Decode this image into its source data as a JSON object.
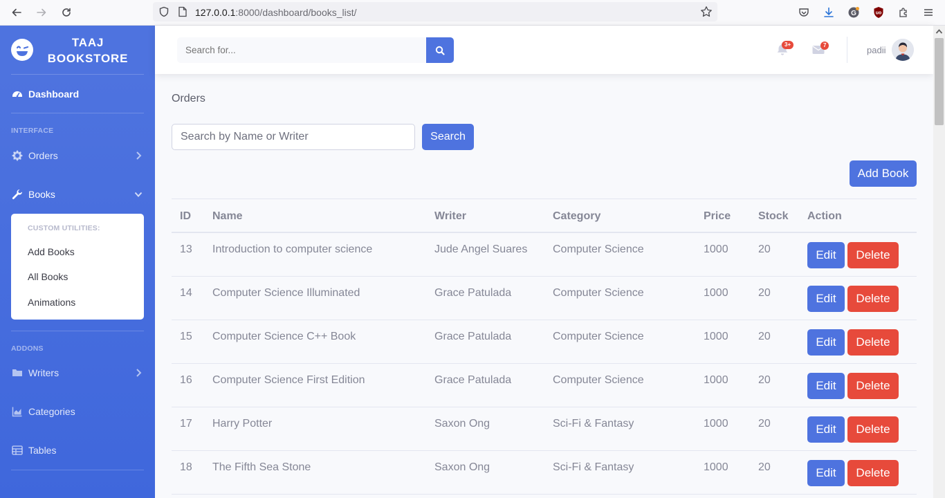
{
  "browser": {
    "url_host": "127.0.0.1",
    "url_rest": ":8000/dashboard/books_list/"
  },
  "brand": {
    "line1": "TAAJ",
    "line2": "BOOKSTORE"
  },
  "sidebar": {
    "dashboard": "Dashboard",
    "heading_interface": "INTERFACE",
    "orders": "Orders",
    "books": "Books",
    "collapse_heading": "CUSTOM UTILITIES:",
    "collapse_items": [
      "Add Books",
      "All Books",
      "Animations"
    ],
    "heading_addons": "ADDONS",
    "writers": "Writers",
    "categories": "Categories",
    "tables": "Tables"
  },
  "topbar": {
    "search_placeholder": "Search for...",
    "alerts_badge": "3+",
    "messages_badge": "7",
    "user_name": "padii"
  },
  "main": {
    "heading": "Orders",
    "search_placeholder": "Search by Name or Writer",
    "search_button": "Search",
    "add_button": "Add Book",
    "columns": [
      "ID",
      "Name",
      "Writer",
      "Category",
      "Price",
      "Stock",
      "Action"
    ],
    "edit_label": "Edit",
    "delete_label": "Delete",
    "rows": [
      {
        "id": "13",
        "name": "Introduction to computer science",
        "writer": "Jude Angel Suares",
        "category": "Computer Science",
        "price": "1000",
        "stock": "20"
      },
      {
        "id": "14",
        "name": "Computer Science Illuminated",
        "writer": "Grace Patulada",
        "category": "Computer Science",
        "price": "1000",
        "stock": "20"
      },
      {
        "id": "15",
        "name": "Computer Science C++ Book",
        "writer": "Grace Patulada",
        "category": "Computer Science",
        "price": "1000",
        "stock": "20"
      },
      {
        "id": "16",
        "name": "Computer Science First Edition",
        "writer": "Grace Patulada",
        "category": "Computer Science",
        "price": "1000",
        "stock": "20"
      },
      {
        "id": "17",
        "name": "Harry Potter",
        "writer": "Saxon Ong",
        "category": "Sci-Fi & Fantasy",
        "price": "1000",
        "stock": "20"
      },
      {
        "id": "18",
        "name": "The Fifth Sea Stone",
        "writer": "Saxon Ong",
        "category": "Sci-Fi & Fantasy",
        "price": "1000",
        "stock": "20"
      }
    ]
  },
  "colors": {
    "primary": "#4e73df",
    "danger": "#e74a3b",
    "text": "#858796"
  }
}
